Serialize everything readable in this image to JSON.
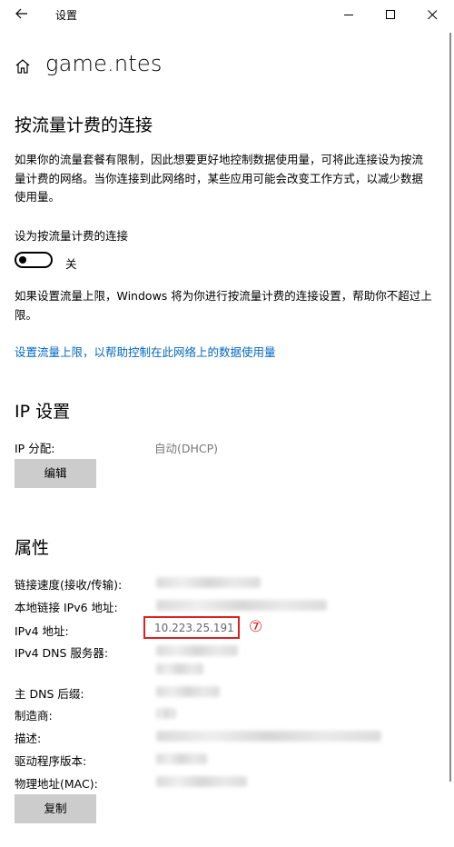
{
  "window": {
    "title": "设置"
  },
  "header": {
    "page_title": "game.ntes"
  },
  "metered": {
    "heading": "按流量计费的连接",
    "description": "如果你的流量套餐有限制，因此想要更好地控制数据使用量，可将此连接设为按流量计费的网络。当你连接到此网络时，某些应用可能会改变工作方式，以减少数据使用量。",
    "toggle_label": "设为按流量计费的连接",
    "toggle_state": "关",
    "limit_note": "如果设置流量上限，Windows 将为你进行按流量计费的连接设置，帮助你不超过上限。",
    "limit_link": "设置流量上限，以帮助控制在此网络上的数据使用量"
  },
  "ip_settings": {
    "heading": "IP 设置",
    "assign_label": "IP 分配:",
    "assign_value": "自动(DHCP)",
    "edit_button": "编辑"
  },
  "properties": {
    "heading": "属性",
    "rows": [
      {
        "label": "链接速度(接收/传输):"
      },
      {
        "label": "本地链接 IPv6 地址:"
      },
      {
        "label": "IPv4 地址:",
        "value": "10.223.25.191"
      },
      {
        "label": "IPv4 DNS 服务器:"
      },
      {
        "label": "主 DNS 后缀:"
      },
      {
        "label": "制造商:"
      },
      {
        "label": "描述:"
      },
      {
        "label": "驱动程序版本:"
      },
      {
        "label": "物理地址(MAC):"
      }
    ],
    "copy_button": "复制"
  },
  "annotation": {
    "marker": "⑦",
    "color": "#e02020"
  },
  "colors": {
    "link": "#0067c0",
    "button_bg": "#cccccc"
  }
}
